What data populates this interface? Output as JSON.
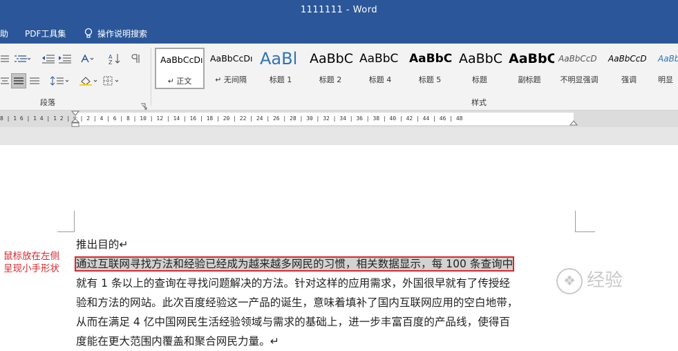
{
  "window": {
    "title": "1111111  -  Word"
  },
  "menu": {
    "items": [
      "助",
      "PDF工具集",
      "操作说明搜索"
    ]
  },
  "ribbon": {
    "paragraph_group_label": "段落",
    "styles_group_label": "样式",
    "styles": [
      {
        "preview": "AaBbCcDı",
        "name": "↵ 正文"
      },
      {
        "preview": "AaBbCcDı",
        "name": "↵ 无间隔"
      },
      {
        "preview": "AaBl",
        "name": "标题 1"
      },
      {
        "preview": "AaBbC",
        "name": "标题 2"
      },
      {
        "preview": "AaBbC",
        "name": "标题 4"
      },
      {
        "preview": "AaBbC",
        "name": "标题 5"
      },
      {
        "preview": "AaBbC",
        "name": "标题"
      },
      {
        "preview": "AaBbC",
        "name": "副标题"
      },
      {
        "preview": "AaBbCcD",
        "name": "不明显强调"
      },
      {
        "preview": "AaBbCcD",
        "name": "强调"
      },
      {
        "preview": "AaBb",
        "name": "明显"
      }
    ]
  },
  "ruler": {
    "text": "8 | 1 6 | 1 4 | 1 2 |  ▽   | 2 |  4 |  6 |  8 | 10 | 12 | 14 | 16 | 18 | 20 | 22 | 24 | 26 | 28 | 30 | 32 | 34 | 36 | 38 | 40 | 42 | 44 | 46 | 48"
  },
  "document": {
    "lines": [
      "推出目的↵",
      "通过互联网寻找方法和经验已经成为越来越多网民的习惯，相关数据显示，每 100 条查询中",
      "就有 1 条以上的查询在寻找问题解决的方法。针对这样的应用需求，外国很早就有了传授经",
      "验和方法的网站。此次百度经验这一产品的诞生，意味着填补了国内互联网应用的空白地带，",
      "从而在满足 4 亿中国网民生活经验领域与需求的基础上，进一步丰富百度的产品线，使得百",
      "度能在更大范围内覆盖和聚合网民力量。↵"
    ]
  },
  "annotation": {
    "line1": "鼠标放在左侧",
    "line2": "呈现小手形状"
  },
  "watermark": {
    "text": "经验"
  },
  "colors": {
    "title_bar": "#2b579a",
    "annotation_red": "#d9262b",
    "selection_gray": "#d2d2d2"
  }
}
